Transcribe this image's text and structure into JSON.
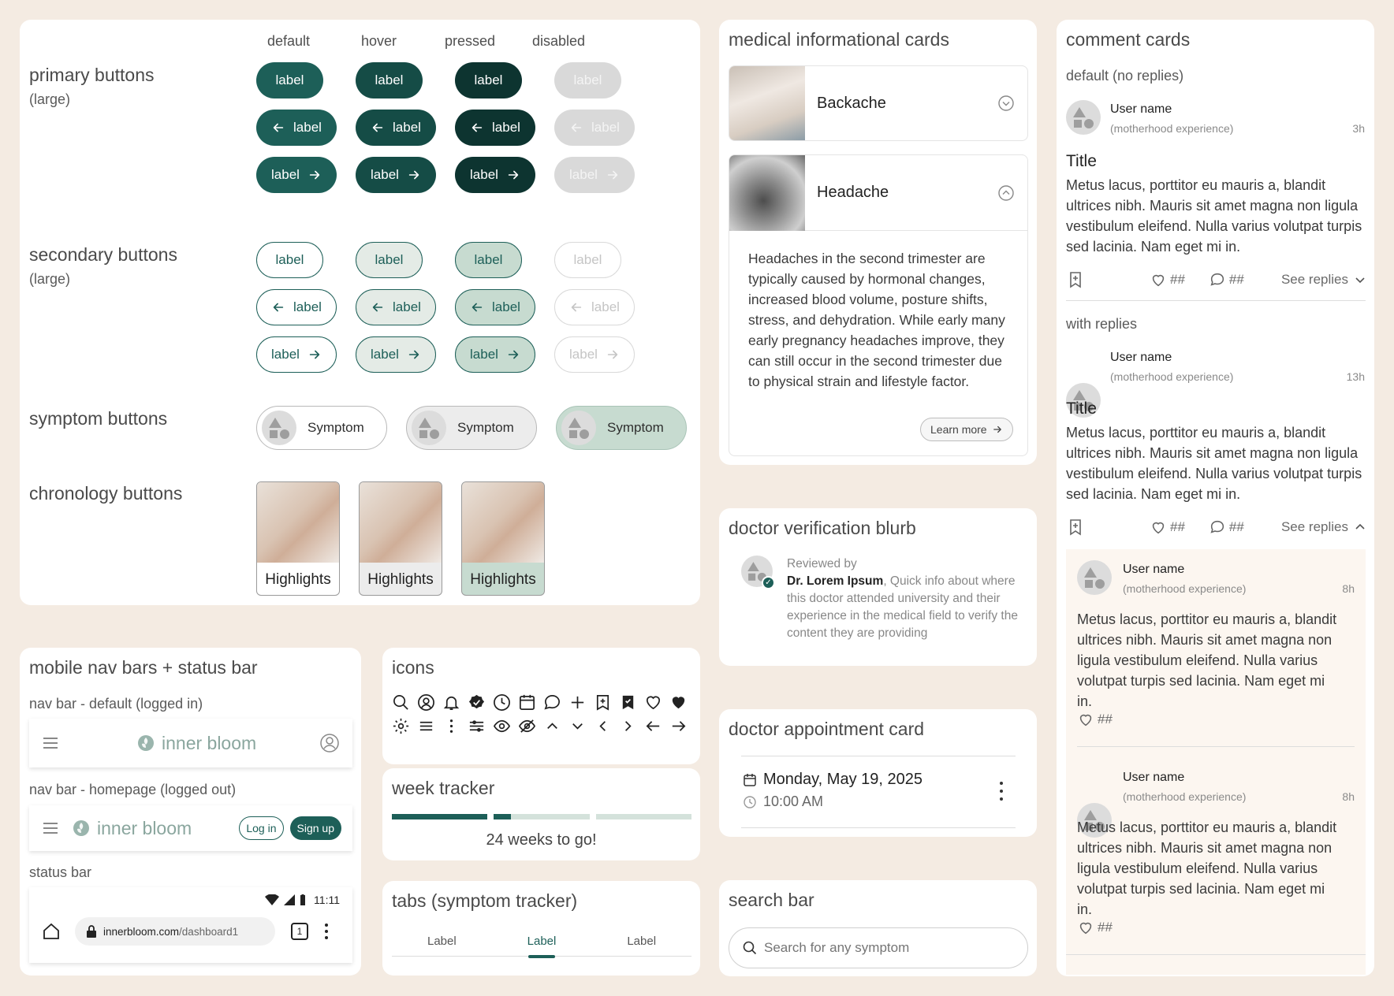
{
  "buttons_card": {
    "columns": [
      "default",
      "hover",
      "pressed",
      "disabled"
    ],
    "primary_title": "primary buttons",
    "primary_sub": "(large)",
    "secondary_title": "secondary buttons",
    "secondary_sub": "(large)",
    "symptom_title": "symptom buttons",
    "chronology_title": "chronology buttons",
    "button_label": "label",
    "symptom_label": "Symptom",
    "highlights_label": "Highlights"
  },
  "medical_cards": {
    "title": "medical informational cards",
    "item1": "Backache",
    "item2": "Headache",
    "body": "Headaches in the second trimester are typically caused by hormonal changes, increased blood volume, posture shifts, stress, and dehydration. While early many early pregnancy headaches improve, they can still occur in the second trimester due to physical strain and lifestyle factor.",
    "learn_more": "Learn more"
  },
  "doctor_blurb": {
    "title": "doctor verification blurb",
    "reviewed_by": "Reviewed by",
    "doctor": "Dr. Lorem Ipsum",
    "info": ", Quick info about where this doctor attended university and their experience in the medical field to verify the content they are providing"
  },
  "appointment": {
    "title": "doctor appointment card",
    "date": "Monday, May 19, 2025",
    "time": "10:00 AM"
  },
  "search": {
    "title": "search bar",
    "placeholder": "Search for any symptom"
  },
  "comments": {
    "title": "comment cards",
    "default_label": "default (no replies)",
    "with_replies_label": "with replies",
    "user": "User name",
    "role": "(motherhood experience)",
    "time1": "3h",
    "time2": "13h",
    "time3": "8h",
    "post_title": "Title",
    "body": "Metus lacus, porttitor eu mauris a, blandit ultrices nibh. Mauris sit amet magna non ligula vestibulum eleifend. Nulla varius volutpat turpis sed lacinia. Nam eget mi in.",
    "count": "##",
    "see_replies": "See replies"
  },
  "navbars": {
    "title": "mobile nav bars + status bar",
    "default_label": "nav bar - default (logged in)",
    "home_label": "nav bar - homepage (logged out)",
    "status_label": "status bar",
    "brand": "inner bloom",
    "login": "Log in",
    "signup": "Sign up",
    "clock": "11:11",
    "url_domain": "innerbloom.com",
    "url_path": "/dashboard1",
    "tab_count": "1"
  },
  "icons": {
    "title": "icons"
  },
  "week_tracker": {
    "title": "week tracker",
    "progress_weeks_done": 16,
    "total_weeks": 40,
    "text": "24 weeks to go!"
  },
  "tabs": {
    "title": "tabs (symptom tracker)",
    "items": [
      "Label",
      "Label",
      "Label"
    ],
    "active": 1
  },
  "colors": {
    "primary": "#1d5f58",
    "primary_hover": "#154c46",
    "primary_pressed": "#0d3430",
    "background": "#f4ebe2"
  }
}
